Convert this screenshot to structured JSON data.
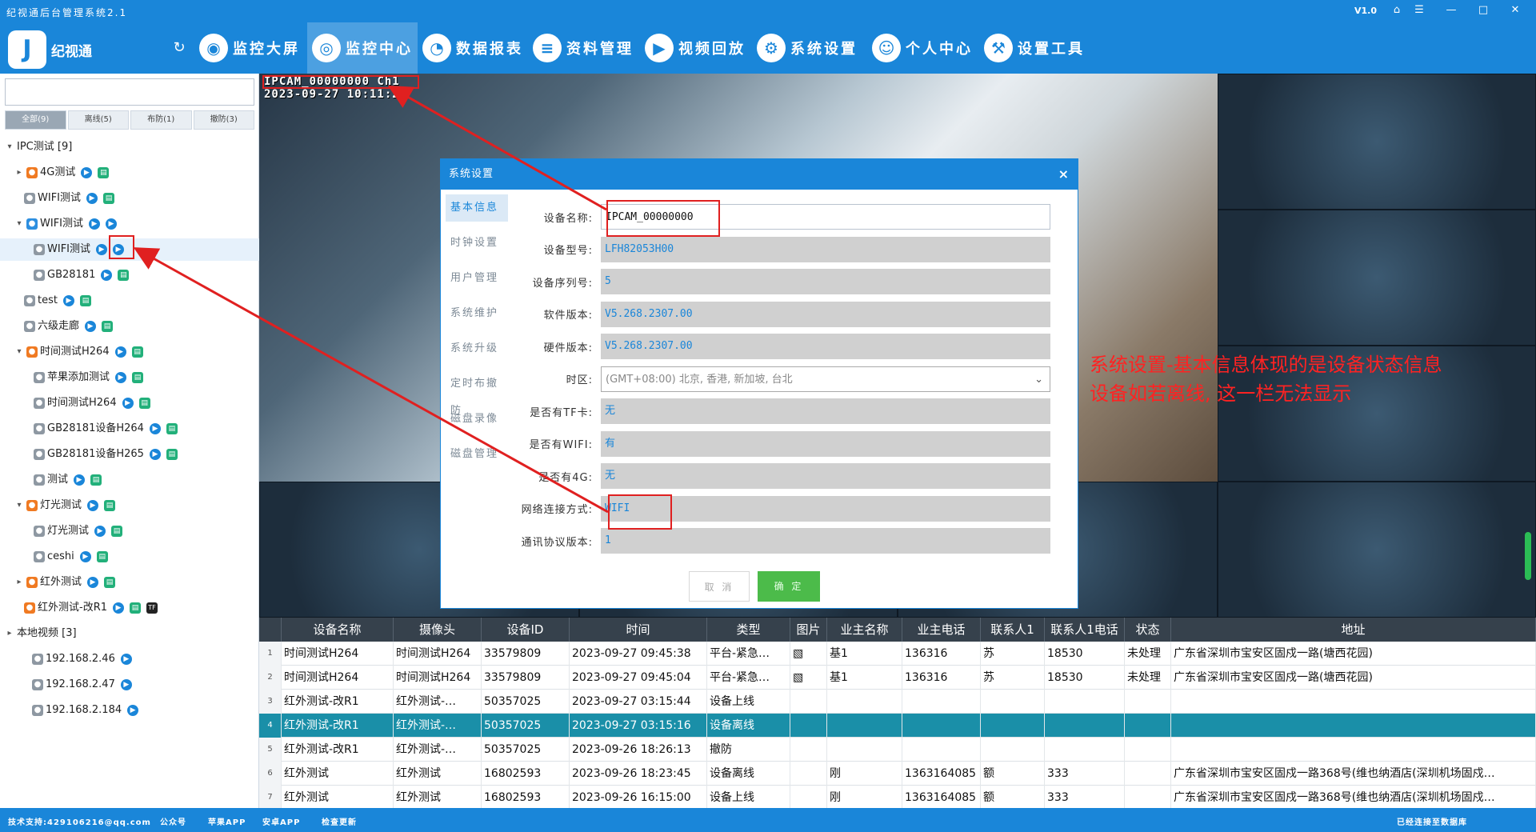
{
  "window": {
    "title": "纪视通后台管理系统2.1",
    "version": "V1.0",
    "controls": [
      "⌂",
      "☰",
      "—",
      "□",
      "✕"
    ]
  },
  "header": {
    "logo_text": "纪视通",
    "refresh_icon": "↻",
    "nav": [
      {
        "label": "监控大屏",
        "icon": "monitor-icon",
        "glyph": "◉"
      },
      {
        "label": "监控中心",
        "icon": "camera-icon",
        "glyph": "◎"
      },
      {
        "label": "数据报表",
        "icon": "pie-chart-icon",
        "glyph": "◔"
      },
      {
        "label": "资料管理",
        "icon": "document-icon",
        "glyph": "≡"
      },
      {
        "label": "视频回放",
        "icon": "play-icon",
        "glyph": "▶"
      },
      {
        "label": "系统设置",
        "icon": "gear-icon",
        "glyph": "⚙"
      },
      {
        "label": "个人中心",
        "icon": "user-icon",
        "glyph": "☺"
      },
      {
        "label": "设置工具",
        "icon": "tools-icon",
        "glyph": "⚒"
      }
    ]
  },
  "left": {
    "filter_tabs": [
      "全部(9)",
      "离线(5)",
      "布防(1)",
      "撤防(3)"
    ],
    "tree": [
      {
        "label": "IPC测试 [9]",
        "arrow": "▾",
        "icons": []
      },
      {
        "label": "4G测试",
        "arrow": "▸",
        "dev": "orange",
        "icons": [
          "p",
          "g"
        ]
      },
      {
        "label": "WIFI测试",
        "arrow": "",
        "dev": "gray",
        "icons": [
          "p",
          "g"
        ]
      },
      {
        "label": "WIFI测试",
        "arrow": "▾",
        "dev": "blue",
        "icons": [
          "p",
          "p"
        ]
      },
      {
        "label": "WIFI测试",
        "arrow": "",
        "dev": "gray",
        "icons": [
          "p",
          "p"
        ]
      },
      {
        "label": "GB28181",
        "arrow": "",
        "dev": "gray",
        "icons": [
          "p",
          "g"
        ]
      },
      {
        "label": "test",
        "arrow": "",
        "dev": "gray",
        "icons": [
          "p",
          "g"
        ]
      },
      {
        "label": "六级走廊",
        "arrow": "",
        "dev": "gray",
        "icons": [
          "p",
          "g"
        ]
      },
      {
        "label": "时间测试H264",
        "arrow": "▾",
        "dev": "orange",
        "icons": [
          "p",
          "g"
        ]
      },
      {
        "label": "苹果添加测试",
        "arrow": "",
        "dev": "gray",
        "icons": [
          "p",
          "g"
        ]
      },
      {
        "label": "时间测试H264",
        "arrow": "",
        "dev": "gray",
        "icons": [
          "p",
          "g"
        ]
      },
      {
        "label": "GB28181设备H264",
        "arrow": "",
        "dev": "gray",
        "icons": [
          "p",
          "g"
        ]
      },
      {
        "label": "GB28181设备H265",
        "arrow": "",
        "dev": "gray",
        "icons": [
          "p",
          "g"
        ]
      },
      {
        "label": "测试",
        "arrow": "",
        "dev": "gray",
        "icons": [
          "p",
          "g"
        ]
      },
      {
        "label": "灯光测试",
        "arrow": "▾",
        "dev": "orange",
        "icons": [
          "p",
          "g"
        ]
      },
      {
        "label": "灯光测试",
        "arrow": "",
        "dev": "gray",
        "icons": [
          "p",
          "g"
        ]
      },
      {
        "label": "ceshi",
        "arrow": "",
        "dev": "gray",
        "icons": [
          "p",
          "g"
        ]
      },
      {
        "label": "红外测试",
        "arrow": "▸",
        "dev": "orange",
        "icons": [
          "p",
          "g"
        ]
      },
      {
        "label": "红外测试-改R1",
        "arrow": "",
        "dev": "orange",
        "icons": [
          "p",
          "g",
          "k"
        ]
      },
      {
        "label": "本地视频 [3]",
        "arrow": "▸",
        "icons": []
      },
      {
        "label": "192.168.2.46",
        "arrow": "",
        "dev": "gray",
        "icons": [
          "p"
        ]
      },
      {
        "label": "192.168.2.47",
        "arrow": "",
        "dev": "gray",
        "icons": [
          "p"
        ]
      },
      {
        "label": "192.168.2.184",
        "arrow": "",
        "dev": "gray",
        "icons": [
          "p"
        ]
      }
    ]
  },
  "video": {
    "osd_line1": "IPCAM_00000000 Ch1",
    "osd_line2": "2023-09-27 10:11:24"
  },
  "dialog": {
    "title": "系统设置",
    "close": "×",
    "side_tabs": [
      "基本信息",
      "时钟设置",
      "用户管理",
      "系统维护",
      "系统升级",
      "定时布撤防",
      "磁盘录像",
      "磁盘管理"
    ],
    "fields": [
      {
        "label": "设备名称:",
        "value": "IPCAM_00000000"
      },
      {
        "label": "设备型号:",
        "value": "LFH82053H00"
      },
      {
        "label": "设备序列号:",
        "value": "5"
      },
      {
        "label": "软件版本:",
        "value": "V5.268.2307.00"
      },
      {
        "label": "硬件版本:",
        "value": "V5.268.2307.00"
      },
      {
        "label": "时区:",
        "value": "(GMT+08:00) 北京, 香港, 新加坡, 台北"
      },
      {
        "label": "是否有TF卡:",
        "value": "无"
      },
      {
        "label": "是否有WIFI:",
        "value": "有"
      },
      {
        "label": "是否有4G:",
        "value": "无"
      },
      {
        "label": "网络连接方式:",
        "value": "WIFI"
      },
      {
        "label": "通讯协议版本:",
        "value": "1"
      }
    ],
    "cancel": "取 消",
    "ok": "确 定"
  },
  "annotation": {
    "line1": "系统设置-基本信息体现的是设备状态信息",
    "line2": "设备如若离线, 这一栏无法显示"
  },
  "table": {
    "headers": [
      "设备名称",
      "摄像头",
      "设备ID",
      "时间",
      "类型",
      "图片",
      "业主名称",
      "业主电话",
      "联系人1",
      "联系人1电话",
      "状态",
      "地址"
    ],
    "rows": [
      [
        "1",
        "时间测试H264",
        "时间测试H264",
        "33579809",
        "2023-09-27  09:45:38",
        "平台-紧急…",
        "▧",
        "基1",
        "136316",
        "苏",
        "18530",
        "未处理",
        "广东省深圳市宝安区固戍一路(塘西花园)"
      ],
      [
        "2",
        "时间测试H264",
        "时间测试H264",
        "33579809",
        "2023-09-27  09:45:04",
        "平台-紧急…",
        "▧",
        "基1",
        "136316",
        "苏",
        "18530",
        "未处理",
        "广东省深圳市宝安区固戍一路(塘西花园)"
      ],
      [
        "3",
        "红外测试-改R1",
        "红外测试-…",
        "50357025",
        "2023-09-27  03:15:44",
        "设备上线",
        "",
        "",
        "",
        "",
        "",
        "",
        ""
      ],
      [
        "4",
        "红外测试-改R1",
        "红外测试-…",
        "50357025",
        "2023-09-27  03:15:16",
        "设备离线",
        "",
        "",
        "",
        "",
        "",
        "",
        ""
      ],
      [
        "5",
        "红外测试-改R1",
        "红外测试-…",
        "50357025",
        "2023-09-26  18:26:13",
        "撤防",
        "",
        "",
        "",
        "",
        "",
        "",
        ""
      ],
      [
        "6",
        "红外测试",
        "红外测试",
        "16802593",
        "2023-09-26  18:23:45",
        "设备离线",
        "",
        "刚",
        "1363164085",
        "额",
        "333",
        "",
        "广东省深圳市宝安区固戍一路368号(维也纳酒店(深圳机场固戍…"
      ],
      [
        "7",
        "红外测试",
        "红外测试",
        "16802593",
        "2023-09-26  16:15:00",
        "设备上线",
        "",
        "刚",
        "1363164085",
        "额",
        "333",
        "",
        "广东省深圳市宝安区固戍一路368号(维也纳酒店(深圳机场固戍…"
      ]
    ]
  },
  "status": {
    "support": "技术支持:429106216@qq.com",
    "public": "公众号",
    "apple": "苹果APP",
    "android": "安卓APP",
    "update": "检查更新",
    "conn": "已经连接至数据库"
  }
}
